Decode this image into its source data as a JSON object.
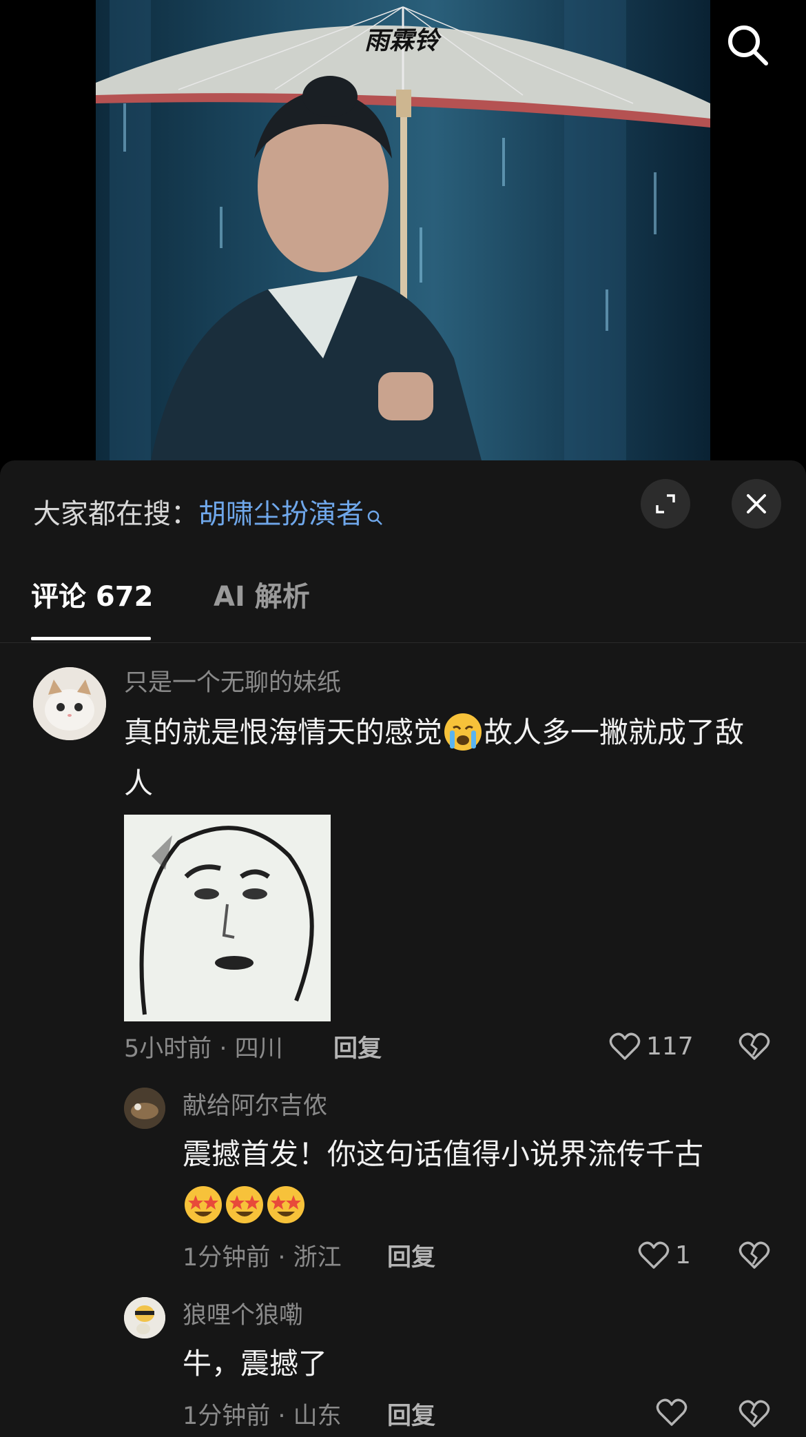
{
  "video": {
    "title_logo": "雨霖铃",
    "search_icon": "search-icon"
  },
  "panel": {
    "hot_search_prefix": "大家都在搜：",
    "hot_search_keyword": "胡啸尘扮演者",
    "tabs": [
      {
        "label": "评论 672",
        "active": true
      },
      {
        "label": "AI 解析",
        "active": false
      }
    ]
  },
  "comments": [
    {
      "username": "只是一个无聊的妹纸",
      "text_part1": "真的就是恨海情天的感觉",
      "text_part2": "故人多一撇就成了敌人",
      "emoji": "loudly-crying-face",
      "has_sticker": true,
      "time_location": "5小时前 · 四川",
      "reply_label": "回复",
      "likes": "117"
    }
  ],
  "replies": [
    {
      "username": "献给阿尔吉侬",
      "text": "震撼首发！你这句话值得小说界流传千古",
      "emojis": [
        "star-struck",
        "star-struck",
        "star-struck"
      ],
      "time_location": "1分钟前 · 浙江",
      "reply_label": "回复",
      "likes": "1"
    },
    {
      "username": "狼哩个狼嘞",
      "text": "牛，震撼了",
      "time_location": "1分钟前 · 山东",
      "reply_label": "回复",
      "likes": ""
    }
  ],
  "colors": {
    "panel_bg": "#161616",
    "keyword": "#6fa7ea",
    "muted": "#8a8a8a"
  }
}
